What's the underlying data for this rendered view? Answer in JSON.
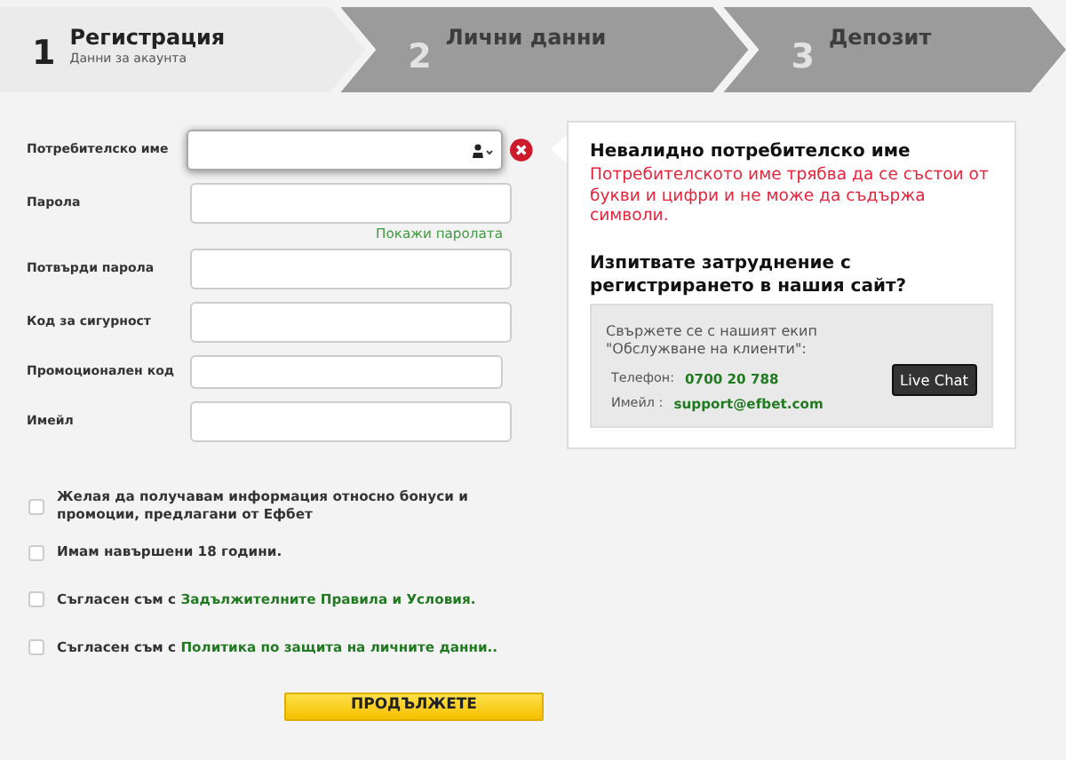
{
  "steps": [
    {
      "number": "1",
      "title": "Регистрация",
      "subtitle": "Данни за акаунта",
      "selected": true
    },
    {
      "number": "2",
      "title": "Лични данни",
      "selected": false
    },
    {
      "number": "3",
      "title": "Депозит",
      "selected": false
    }
  ],
  "fields": [
    {
      "label": "Потребителско име",
      "kind": "username",
      "error": true
    },
    {
      "label": "Парола",
      "kind": "password",
      "error": false,
      "link": "Покажи паролата"
    },
    {
      "label": "Потвърди парола",
      "kind": "password",
      "error": false
    },
    {
      "label": "Код за сигурност",
      "kind": "text",
      "error": false
    },
    {
      "label": "Промоционален код",
      "kind": "text",
      "error": false
    },
    {
      "label": "Имейл",
      "kind": "text",
      "error": false
    }
  ],
  "error_panel": {
    "title": "Невалидно потребителско име",
    "message": "Потребителското име трябва да се състои от букви и цифри и не може да съдържа символи.",
    "help_title": "Изпитвате затруднение с регистрирането в нашия сайт?",
    "help": {
      "intro": "Свържете се с нашият екип \"Обслужване на клиенти\":",
      "phone_label": "Телефон:",
      "phone": "0700 20 788",
      "email_label": "Имейл :",
      "email": "support@efbet.com",
      "chat_button": "Live Chat"
    }
  },
  "checkboxes": [
    {
      "text": "Желая да получавам информация относно бонуси и промоции, предлагани от Ефбет",
      "checked": false
    },
    {
      "text": "Имам навършени 18 години.",
      "checked": false
    },
    {
      "text": "Съгласен съм с ",
      "link": "Задължителните Правила и Условия.",
      "checked": false
    },
    {
      "text": "Съгласен съм с ",
      "link": "Политика по защита на личните данни..",
      "checked": false
    }
  ],
  "submit": "ПРОДЪЛЖЕТЕ"
}
